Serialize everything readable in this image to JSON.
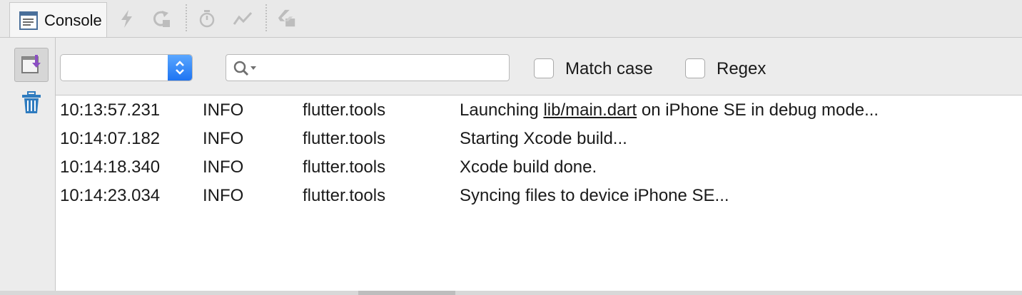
{
  "window": {
    "tab_label": "Console",
    "toolbar_icons": [
      "lightning-icon",
      "reload-icon",
      "stopwatch-icon",
      "trend-icon",
      "toggle-platform-icon"
    ]
  },
  "sidebar": {
    "icons": [
      "scroll-to-end-icon",
      "trash-icon"
    ]
  },
  "filter": {
    "select_value": "",
    "search_value": "",
    "search_placeholder": "",
    "match_case_label": "Match case",
    "match_case_checked": false,
    "regex_label": "Regex",
    "regex_checked": false
  },
  "logs": [
    {
      "time": "10:13:57.231",
      "level": "INFO",
      "tag": "flutter.tools",
      "msg_before": "Launching ",
      "msg_link": "lib/main.dart",
      "msg_after": " on iPhone SE in debug mode..."
    },
    {
      "time": "10:14:07.182",
      "level": "INFO",
      "tag": "flutter.tools",
      "msg_before": "Starting Xcode build...",
      "msg_link": "",
      "msg_after": ""
    },
    {
      "time": "10:14:18.340",
      "level": "INFO",
      "tag": "flutter.tools",
      "msg_before": "Xcode build done.",
      "msg_link": "",
      "msg_after": ""
    },
    {
      "time": "10:14:23.034",
      "level": "INFO",
      "tag": "flutter.tools",
      "msg_before": "Syncing files to device iPhone SE...",
      "msg_link": "",
      "msg_after": ""
    }
  ],
  "colors": {
    "accent": "#1e74f2",
    "link": "#1a1adb",
    "trash": "#2e7bbf",
    "scroll_arrow": "#8c4fc4"
  }
}
